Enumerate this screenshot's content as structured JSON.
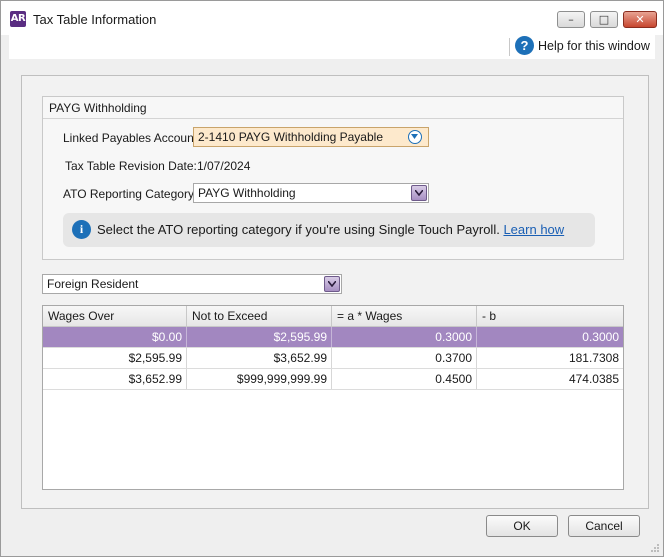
{
  "window": {
    "app_icon": "AR",
    "title": "Tax Table Information",
    "minimize_glyph": "–",
    "maximize_glyph": "□",
    "close_glyph": "✕"
  },
  "help": {
    "icon": "?",
    "label": "Help for this window"
  },
  "payg": {
    "group_title": "PAYG Withholding",
    "linked_account_label": "Linked Payables Account:",
    "linked_account_value": "2-1410 PAYG Withholding Payable",
    "revision_date_label": "Tax Table Revision Date:",
    "revision_date_value": "1/07/2024",
    "ato_category_label": "ATO Reporting Category:",
    "ato_category_value": "PAYG Withholding",
    "info_icon": "i",
    "info_text": "Select the ATO reporting category if you're using Single Touch Payroll.",
    "info_link": "Learn how"
  },
  "residency": {
    "selected": "Foreign Resident"
  },
  "table": {
    "headers": [
      "Wages Over",
      "Not to Exceed",
      "= a * Wages",
      "- b"
    ],
    "rows": [
      {
        "selected": true,
        "cells": [
          "$0.00",
          "$2,595.99",
          "0.3000",
          "0.3000"
        ]
      },
      {
        "selected": false,
        "cells": [
          "$2,595.99",
          "$3,652.99",
          "0.3700",
          "181.7308"
        ]
      },
      {
        "selected": false,
        "cells": [
          "$3,652.99",
          "$999,999,999.99",
          "0.4500",
          "474.0385"
        ]
      }
    ]
  },
  "buttons": {
    "ok": "OK",
    "cancel": "Cancel"
  },
  "colors": {
    "accent": "#a287c0",
    "link": "#1a5fb4",
    "info": "#1d70b8",
    "field_highlight": "#fde9cc"
  }
}
